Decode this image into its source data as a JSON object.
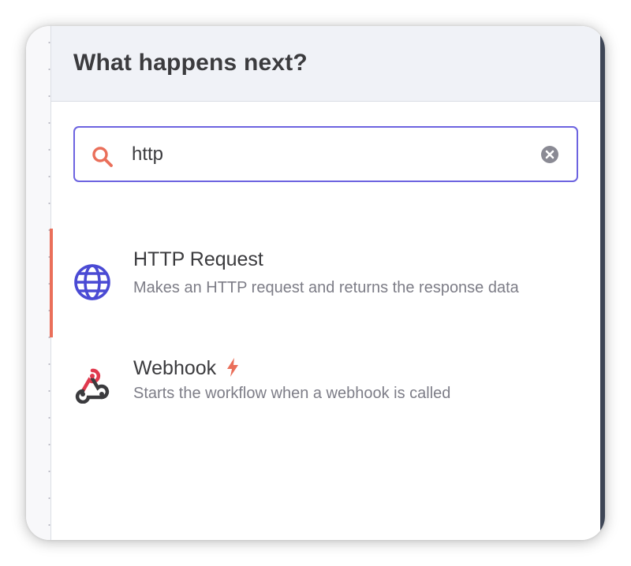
{
  "panel": {
    "title": "What happens next?"
  },
  "search": {
    "value": "http",
    "placeholder": ""
  },
  "results": [
    {
      "title": "HTTP Request",
      "description": "Makes an HTTP request and returns the response data",
      "icon": "globe-icon",
      "active": true
    },
    {
      "title": "Webhook",
      "description": "Starts the workflow when a webhook is called",
      "icon": "webhook-icon",
      "badge_icon": "lightning-bolt-icon"
    }
  ],
  "colors": {
    "accent": "#6c63e0",
    "search_icon": "#ea6f5a",
    "active_bar": "#ea6f5a",
    "globe": "#4a4ad4",
    "trigger_bolt": "#ea6f5a",
    "webhook_red": "#e0394e",
    "webhook_dark": "#3b3b3e"
  }
}
